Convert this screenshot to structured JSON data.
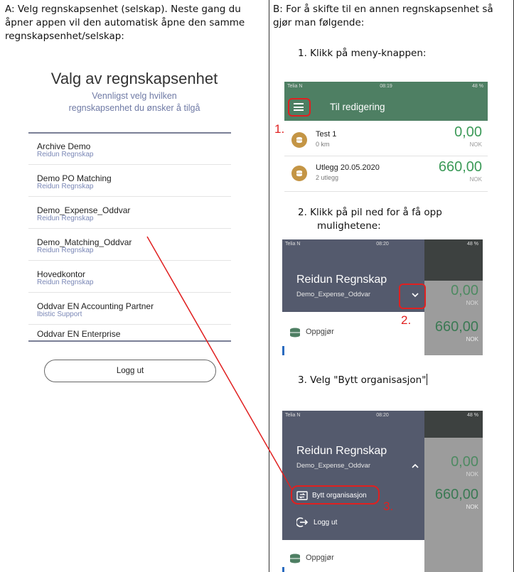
{
  "left": {
    "heading_lines": [
      "A: Velg regnskapsenhet (selskap). Neste gang du",
      "åpner appen vil den automatisk åpne den samme",
      "regnskapsenhet/selskap:"
    ],
    "title": "Valg av regnskapsenhet",
    "subtitle_lines": [
      "Vennligst velg hvilken",
      "regnskapsenhet du ønsker å tilgå"
    ],
    "items": [
      {
        "name": "Archive Demo",
        "org": "Reidun Regnskap"
      },
      {
        "name": "Demo PO Matching",
        "org": "Reidun Regnskap"
      },
      {
        "name": "Demo_Expense_Oddvar",
        "org": "Reidun Regnskap"
      },
      {
        "name": "Demo_Matching_Oddvar",
        "org": "Reidun  Regnskap"
      },
      {
        "name": "Hovedkontor",
        "org": "Reidun Regnskap"
      },
      {
        "name": "Oddvar EN Accounting Partner",
        "org": "Ibistic Support"
      },
      {
        "name": "Oddvar EN Enterprise",
        "org": ""
      }
    ],
    "logout": "Logg ut"
  },
  "right": {
    "heading_lines": [
      "B: For å skifte til en annen regnskapsenhet så",
      "gjør man følgende:"
    ],
    "step1": "1.   Klikk på meny-knappen:",
    "step2_lines": [
      "2.   Klikk på pil ned for å få opp",
      "mulighetene:"
    ],
    "step3": "3.   Velg \"Bytt organisasjon\"",
    "shot1": {
      "carrier": "Telia N",
      "time": "08:19",
      "battery": "48 %",
      "header": "Til redigering",
      "rows": [
        {
          "title": "Test 1",
          "sub": "0 km",
          "amount": "0,00",
          "currency": "NOK"
        },
        {
          "title": "Utlegg 20.05.2020",
          "sub": "2 utlegg",
          "amount": "660,00",
          "currency": "NOK"
        }
      ],
      "marker": "1."
    },
    "shot2": {
      "carrier": "Telia N",
      "time": "08:20",
      "battery": "48 %",
      "company": "Reidun Regnskap",
      "unit": "Demo_Expense_Oddvar",
      "menu_item": "Oppgjør",
      "amounts": [
        "0,00",
        "660,00"
      ],
      "currency": "NOK",
      "marker": "2."
    },
    "shot3": {
      "carrier": "Telia N",
      "time": "08:20",
      "battery": "48 %",
      "company": "Reidun Regnskap",
      "unit": "Demo_Expense_Oddvar",
      "switch_org": "Bytt organisasjon",
      "logout": "Logg ut",
      "menu_item": "Oppgjør",
      "amounts": [
        "0,00",
        "660,00"
      ],
      "currency": "NOK",
      "marker": "3."
    }
  },
  "colors": {
    "app_green": "#4e7f63",
    "drawer": "#545a6d",
    "annotation_red": "#e02020",
    "amount_green": "#3c9a58",
    "coin": "#c49545"
  }
}
